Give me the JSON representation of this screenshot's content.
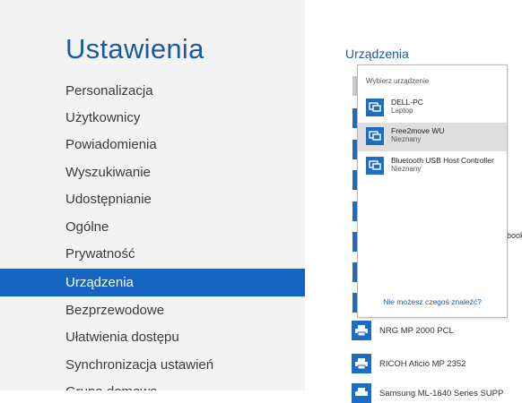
{
  "settings": {
    "title": "Ustawienia",
    "items": [
      {
        "label": "Personalizacja"
      },
      {
        "label": "Użytkownicy"
      },
      {
        "label": "Powiadomienia"
      },
      {
        "label": "Wyszukiwanie"
      },
      {
        "label": "Udostępnianie"
      },
      {
        "label": "Ogólne"
      },
      {
        "label": "Prywatność"
      },
      {
        "label": "Urządzenia",
        "selected": true
      },
      {
        "label": "Bezprzewodowe"
      },
      {
        "label": "Ułatwienia dostępu"
      },
      {
        "label": "Synchronizacja ustawień"
      },
      {
        "label": "Grupa domowa"
      }
    ]
  },
  "devices_page": {
    "title": "Urządzenia",
    "partial_label": "book",
    "devices": [
      {
        "name": "NRG MP 2000 PCL",
        "icon": "printer-icon"
      },
      {
        "name": "RICOH Aficio MP 2352",
        "icon": "printer-icon"
      },
      {
        "name": "Samsung ML-1640 Series SUPP",
        "icon": "printer-icon"
      }
    ]
  },
  "flyout": {
    "header": "Wybierz urządzenie",
    "items": [
      {
        "name": "DELL-PC",
        "sub": "Laptop",
        "icon": "pc-icon"
      },
      {
        "name": "Free2move WU",
        "sub": "Nieznany",
        "icon": "pc-icon",
        "highlighted": true
      },
      {
        "name": "Bluetooth USB Host Controller",
        "sub": "Nieznany",
        "icon": "pc-icon"
      }
    ],
    "link": "Nie możesz czegoś znaleźć?"
  },
  "colors": {
    "accent": "#1565c0",
    "title": "#1d5a9c",
    "tile": "#1d6ec2"
  }
}
